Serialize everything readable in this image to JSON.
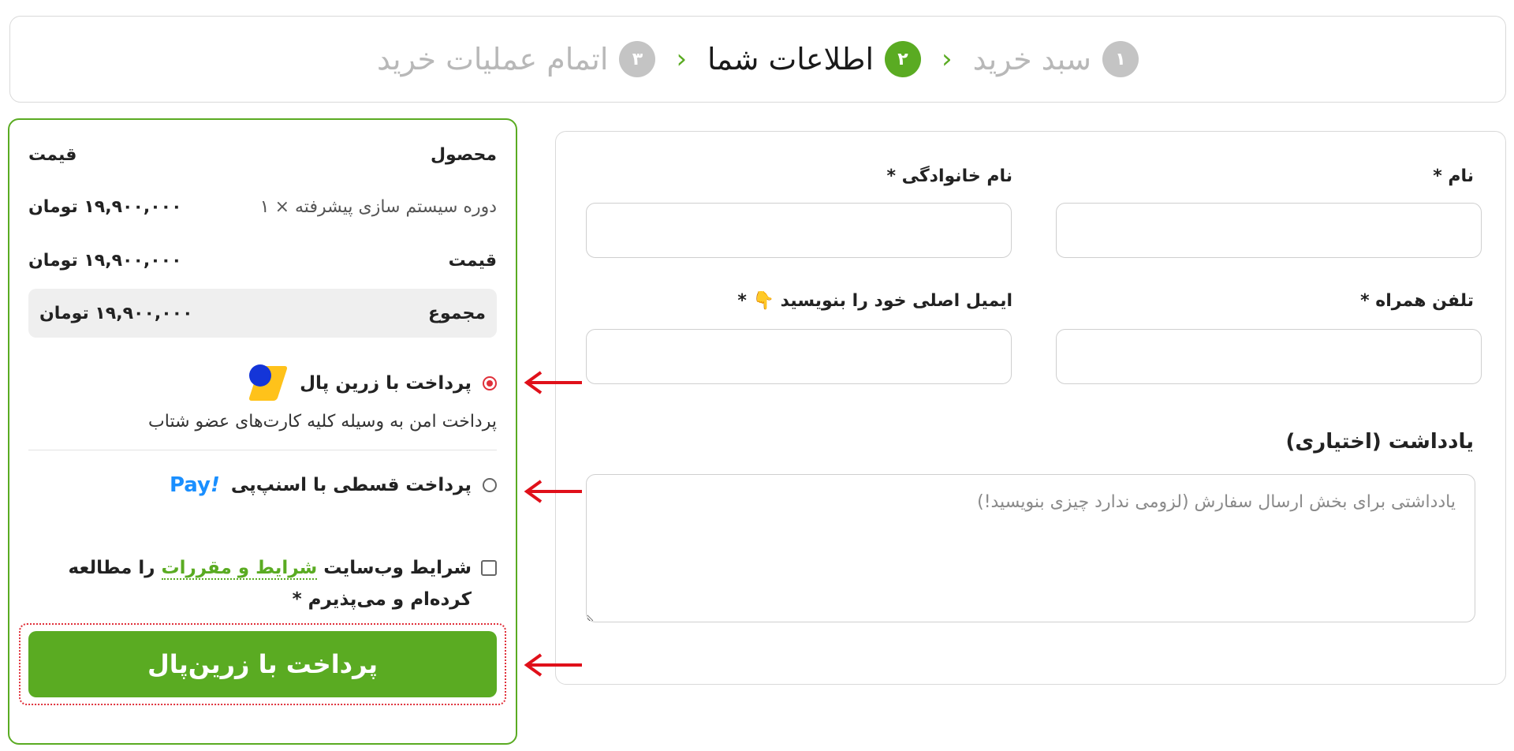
{
  "steps": [
    {
      "num": "۱",
      "label": "سبد خرید"
    },
    {
      "num": "۲",
      "label": "اطلاعات شما"
    },
    {
      "num": "۳",
      "label": "اتمام عملیات خرید"
    }
  ],
  "step_separator": "›",
  "form": {
    "first_name_label": "نام *",
    "last_name_label": "نام خانوادگی *",
    "phone_label": "تلفن همراه *",
    "email_label": "ایمیل اصلی خود را بنویسید 👇 *",
    "note_title": "یادداشت (اختیاری)",
    "note_placeholder": "یادداشتی برای بخش ارسال سفارش (لزومی ندارد چیزی بنویسید!)"
  },
  "order": {
    "col_product": "محصول",
    "col_price": "قیمت",
    "item_name": "دوره سیستم سازی پیشرفته  × ۱",
    "item_price": "۱۹,۹۰۰,۰۰۰ تومان",
    "subtotal_label": "قیمت",
    "subtotal_value": "۱۹,۹۰۰,۰۰۰ تومان",
    "total_label": "مجموع",
    "total_value": "۱۹,۹۰۰,۰۰۰ تومان"
  },
  "payment": {
    "zarinpal_label": "پرداخت با زرین پال",
    "zarinpal_desc": "پرداخت امن به وسیله کلیه کارت‌های عضو شتاب",
    "snapp_label": "پرداخت قسطی با اسنپ‌پی",
    "snapp_logo_text": "Pay",
    "snapp_logo_mark": "!"
  },
  "terms": {
    "prefix": "شرایط وب‌سایت",
    "link": "شرایط و مقررات",
    "suffix": "را مطالعه کرده‌ام و می‌پذیرم *"
  },
  "submit_label": "پرداخت با زرین‌پال",
  "colors": {
    "accent": "#5aab22",
    "arrow": "#e0101a",
    "inactive_step": "#c4c4c4"
  }
}
